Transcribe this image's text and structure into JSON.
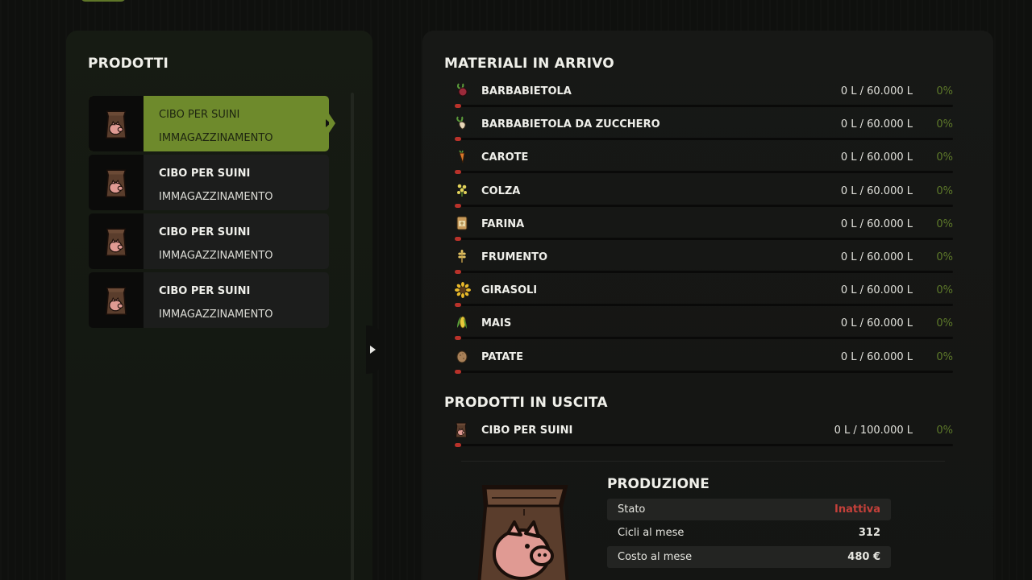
{
  "colors": {
    "accent": "#6e8a2c",
    "percent_green": "#5e7a2a",
    "status_inactive": "#c5403a",
    "fill_dot": "#b9322a"
  },
  "left_panel": {
    "title": "PRODOTTI",
    "items": [
      {
        "name": "CIBO PER SUINI",
        "sub": "IMMAGAZZINAMENTO",
        "icon": "pig-feed-bag-icon",
        "selected": true
      },
      {
        "name": "CIBO PER SUINI",
        "sub": "IMMAGAZZINAMENTO",
        "icon": "pig-feed-bag-icon",
        "selected": false
      },
      {
        "name": "CIBO PER SUINI",
        "sub": "IMMAGAZZINAMENTO",
        "icon": "pig-feed-bag-icon",
        "selected": false
      },
      {
        "name": "CIBO PER SUINI",
        "sub": "IMMAGAZZINAMENTO",
        "icon": "pig-feed-bag-icon",
        "selected": false
      }
    ]
  },
  "incoming": {
    "title": "MATERIALI IN ARRIVO",
    "items": [
      {
        "name": "BARBABIETOLA",
        "amount": "0 L / 60.000 L",
        "pct": "0%",
        "icon": "beetroot-icon",
        "fill": 0
      },
      {
        "name": "BARBABIETOLA DA ZUCCHERO",
        "amount": "0 L / 60.000 L",
        "pct": "0%",
        "icon": "sugar-beet-icon",
        "fill": 0
      },
      {
        "name": "CAROTE",
        "amount": "0 L / 60.000 L",
        "pct": "0%",
        "icon": "carrot-icon",
        "fill": 0
      },
      {
        "name": "COLZA",
        "amount": "0 L / 60.000 L",
        "pct": "0%",
        "icon": "canola-icon",
        "fill": 0
      },
      {
        "name": "FARINA",
        "amount": "0 L / 60.000 L",
        "pct": "0%",
        "icon": "flour-icon",
        "fill": 0
      },
      {
        "name": "FRUMENTO",
        "amount": "0 L / 60.000 L",
        "pct": "0%",
        "icon": "wheat-icon",
        "fill": 0
      },
      {
        "name": "GIRASOLI",
        "amount": "0 L / 60.000 L",
        "pct": "0%",
        "icon": "sunflower-icon",
        "fill": 0
      },
      {
        "name": "MAIS",
        "amount": "0 L / 60.000 L",
        "pct": "0%",
        "icon": "corn-icon",
        "fill": 0
      },
      {
        "name": "PATATE",
        "amount": "0 L / 60.000 L",
        "pct": "0%",
        "icon": "potato-icon",
        "fill": 0
      }
    ]
  },
  "outgoing": {
    "title": "PRODOTTI IN USCITA",
    "items": [
      {
        "name": "CIBO PER SUINI",
        "amount": "0 L / 100.000 L",
        "pct": "0%",
        "icon": "pig-feed-bag-icon",
        "fill": 0
      }
    ]
  },
  "production": {
    "title": "PRODUZIONE",
    "rows": [
      {
        "label": "Stato",
        "value": "Inattiva",
        "status": "inactive"
      },
      {
        "label": "Cicli al mese",
        "value": "312"
      },
      {
        "label": "Costo al mese",
        "value": "480 €"
      }
    ]
  }
}
